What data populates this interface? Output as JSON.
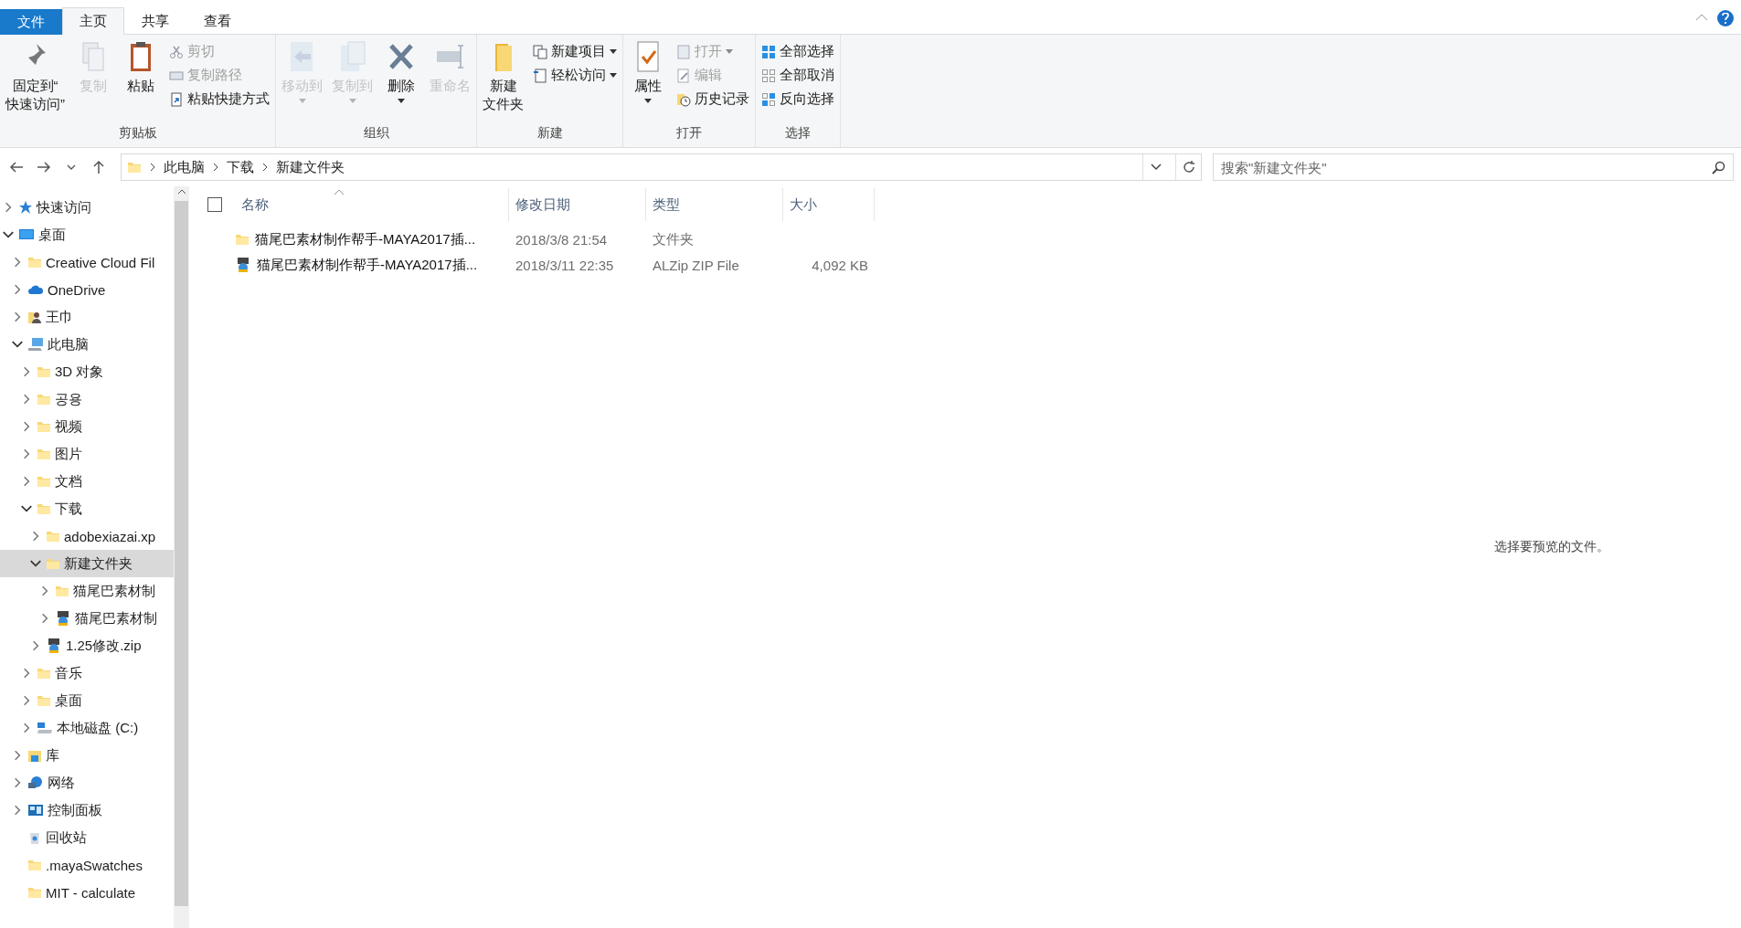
{
  "ribbon_tabs": [
    {
      "label": "文件",
      "kind": "file",
      "selected": false
    },
    {
      "label": "主页",
      "kind": "tab",
      "selected": true
    },
    {
      "label": "共享",
      "kind": "tab",
      "selected": false
    },
    {
      "label": "查看",
      "kind": "tab",
      "selected": false
    }
  ],
  "ribbon_groups": [
    {
      "label": "剪贴板",
      "buttons": [
        {
          "lines": [
            "固定到“",
            "快速访问”"
          ],
          "kind": "large",
          "disabled": false,
          "dropdown": false
        },
        {
          "label": "复制",
          "kind": "large",
          "disabled": true,
          "dropdown": false
        },
        {
          "label": "粘贴",
          "kind": "large",
          "disabled": false,
          "dropdown": false
        },
        {
          "kind": "stack",
          "items": [
            {
              "label": "剪切",
              "disabled": true,
              "dropdown": false
            },
            {
              "label": "复制路径",
              "disabled": true,
              "dropdown": false
            },
            {
              "label": "粘贴快捷方式",
              "disabled": false,
              "dropdown": false
            }
          ]
        }
      ]
    },
    {
      "label": "组织",
      "buttons": [
        {
          "label": "移动到",
          "kind": "large",
          "disabled": true,
          "dropdown": true
        },
        {
          "label": "复制到",
          "kind": "large",
          "disabled": true,
          "dropdown": true
        },
        {
          "label": "删除",
          "kind": "large",
          "disabled": false,
          "dropdown": true
        },
        {
          "label": "重命名",
          "kind": "large",
          "disabled": true,
          "dropdown": false
        }
      ]
    },
    {
      "label": "新建",
      "buttons": [
        {
          "lines": [
            "新建",
            "文件夹"
          ],
          "kind": "large",
          "disabled": false,
          "dropdown": false
        },
        {
          "kind": "stack",
          "items": [
            {
              "label": "新建项目",
              "disabled": false,
              "dropdown": true
            },
            {
              "label": "轻松访问",
              "disabled": false,
              "dropdown": true
            }
          ]
        }
      ]
    },
    {
      "label": "打开",
      "buttons": [
        {
          "label": "属性",
          "kind": "large",
          "disabled": false,
          "dropdown": true
        },
        {
          "kind": "stack",
          "items": [
            {
              "label": "打开",
              "disabled": true,
              "dropdown": true
            },
            {
              "label": "编辑",
              "disabled": true,
              "dropdown": false
            },
            {
              "label": "历史记录",
              "disabled": false,
              "dropdown": false
            }
          ]
        }
      ]
    },
    {
      "label": "选择",
      "buttons": [
        {
          "kind": "stack",
          "items": [
            {
              "label": "全部选择",
              "disabled": false,
              "dropdown": false
            },
            {
              "label": "全部取消",
              "disabled": false,
              "dropdown": false
            },
            {
              "label": "反向选择",
              "disabled": false,
              "dropdown": false
            }
          ]
        }
      ]
    }
  ],
  "address": {
    "crumbs": [
      "此电脑",
      "下载",
      "新建文件夹"
    ]
  },
  "search": {
    "placeholder": "搜索\"新建文件夹\""
  },
  "tree": [
    {
      "label": "快速访问",
      "kind": "star",
      "expandable": true,
      "expanded": false,
      "selected": false
    },
    {
      "label": "桌面",
      "kind": "desktop",
      "expandable": true,
      "expanded": true,
      "selected": false,
      "children": [
        {
          "label": "Creative Cloud Fil",
          "kind": "folder",
          "expandable": true,
          "expanded": false,
          "selected": false
        },
        {
          "label": "OneDrive",
          "kind": "cloud",
          "expandable": true,
          "expanded": false,
          "selected": false
        },
        {
          "label": "王巾",
          "kind": "user",
          "expandable": true,
          "expanded": false,
          "selected": false
        },
        {
          "label": "此电脑",
          "kind": "computer",
          "expandable": true,
          "expanded": true,
          "selected": false,
          "children": [
            {
              "label": "3D 对象",
              "kind": "folder",
              "expandable": true,
              "expanded": false,
              "selected": false
            },
            {
              "label": "공용",
              "kind": "folder",
              "expandable": true,
              "expanded": false,
              "selected": false
            },
            {
              "label": "视频",
              "kind": "folder",
              "expandable": true,
              "expanded": false,
              "selected": false
            },
            {
              "label": "图片",
              "kind": "folder",
              "expandable": true,
              "expanded": false,
              "selected": false
            },
            {
              "label": "文档",
              "kind": "folder",
              "expandable": true,
              "expanded": false,
              "selected": false
            },
            {
              "label": "下载",
              "kind": "folder",
              "expandable": true,
              "expanded": true,
              "selected": false,
              "children": [
                {
                  "label": "adobexiazai.xp",
                  "kind": "folder",
                  "expandable": true,
                  "expanded": false,
                  "selected": false
                },
                {
                  "label": "新建文件夹",
                  "kind": "folder",
                  "expandable": true,
                  "expanded": true,
                  "selected": true,
                  "children": [
                    {
                      "label": "猫尾巴素材制",
                      "kind": "folder",
                      "expandable": true,
                      "expanded": false,
                      "selected": false
                    },
                    {
                      "label": "猫尾巴素材制",
                      "kind": "zip",
                      "expandable": true,
                      "expanded": false,
                      "selected": false
                    }
                  ]
                },
                {
                  "label": "1.25修改.zip",
                  "kind": "zip",
                  "expandable": true,
                  "expanded": false,
                  "selected": false
                }
              ]
            },
            {
              "label": "音乐",
              "kind": "folder",
              "expandable": true,
              "expanded": false,
              "selected": false
            },
            {
              "label": "桌面",
              "kind": "folder",
              "expandable": true,
              "expanded": false,
              "selected": false
            },
            {
              "label": "本地磁盘 (C:)",
              "kind": "drive",
              "expandable": true,
              "expanded": false,
              "selected": false
            }
          ]
        },
        {
          "label": "库",
          "kind": "library",
          "expandable": true,
          "expanded": false,
          "selected": false
        },
        {
          "label": "网络",
          "kind": "network",
          "expandable": true,
          "expanded": false,
          "selected": false
        },
        {
          "label": "控制面板",
          "kind": "control",
          "expandable": true,
          "expanded": false,
          "selected": false
        },
        {
          "label": "回收站",
          "kind": "recycle",
          "expandable": false,
          "selected": false
        },
        {
          "label": ".mayaSwatches",
          "kind": "folder",
          "expandable": false,
          "selected": false
        },
        {
          "label": "MIT - calculate",
          "kind": "folder",
          "expandable": false,
          "selected": false
        }
      ]
    }
  ],
  "select_all": {
    "checked": false
  },
  "columns": [
    "名称",
    "修改日期",
    "类型",
    "大小"
  ],
  "rows": [
    {
      "kind": "folder",
      "name": "猫尾巴素材制作帮手-MAYA2017插...",
      "modified": "2018/3/8 21:54",
      "type": "文件夹"
    },
    {
      "kind": "zip",
      "name": "猫尾巴素材制作帮手-MAYA2017插...",
      "modified": "2018/3/11 22:35",
      "type": "ALZip ZIP File",
      "size": "4,092 KB"
    }
  ],
  "preview": {
    "message": "选择要预览的文件。"
  }
}
